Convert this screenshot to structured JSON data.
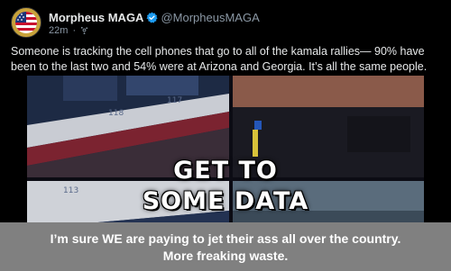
{
  "post": {
    "author_name": "Morpheus MAGA",
    "handle": "@MorpheusMAGA",
    "timestamp": "22m",
    "separator": "·",
    "verified_icon": "verified-badge-icon",
    "privacy_icon": "fediverse-globe-icon",
    "text": "Someone is tracking the cell phones that go to all of the kamala rallies— 90% have been to the last two and 54% were at Arizona and Georgia. It’s all the same people."
  },
  "media": {
    "overlay_line_1": "GET TO",
    "overlay_line_2": "SOME DATA",
    "section_label_1": "118",
    "section_label_2": "117",
    "section_label_3": "113"
  },
  "caption": {
    "line_1": "I’m sure WE are paying to jet their ass all over the country.",
    "line_2": "More freaking waste."
  },
  "colors": {
    "post_background": "#000000",
    "verified": "#1d9bf0",
    "caption_background": "#808080",
    "handle_gray": "#8b98a5"
  }
}
